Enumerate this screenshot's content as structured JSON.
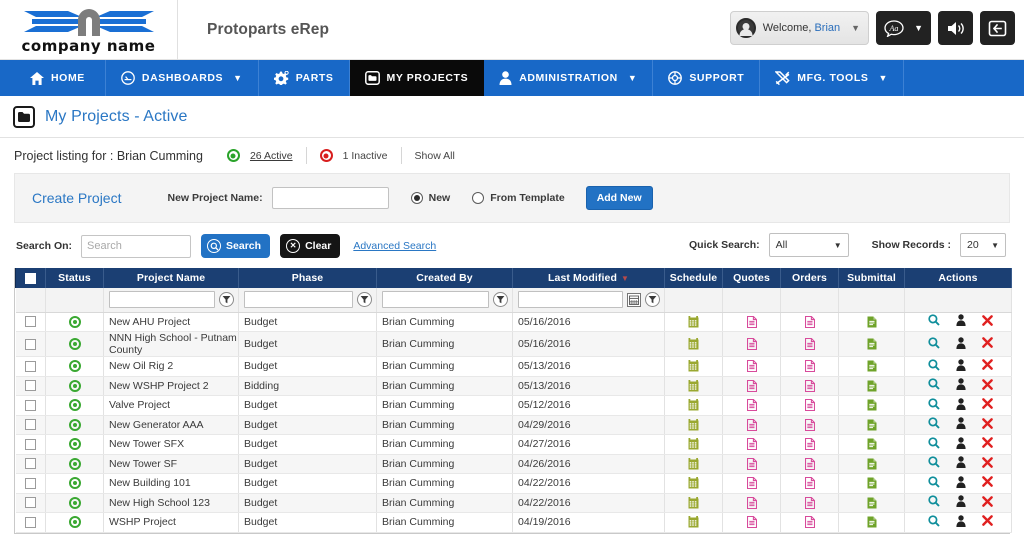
{
  "header": {
    "logo_text": "company name",
    "app_title": "Protoparts eRep",
    "welcome_prefix": "Welcome, ",
    "welcome_user": "Brian",
    "icons": {
      "user_avatar": "avatar-icon",
      "chevron": "chevron-down-icon",
      "translate": "translate-speech-icon",
      "sound": "speaker-icon",
      "logout": "logout-icon"
    },
    "accent_blue": "#1868c7",
    "link_blue": "#2a77c4"
  },
  "nav": {
    "items": [
      {
        "label": "HOME",
        "icon": "home-icon",
        "caret": false,
        "active": false
      },
      {
        "label": "DASHBOARDS",
        "icon": "dashboard-gauge-icon",
        "caret": true,
        "active": false
      },
      {
        "label": "PARTS",
        "icon": "gear-icon",
        "caret": false,
        "active": false
      },
      {
        "label": "MY PROJECTS",
        "icon": "folder-icon",
        "caret": false,
        "active": true
      },
      {
        "label": "ADMINISTRATION",
        "icon": "person-icon",
        "caret": true,
        "active": false
      },
      {
        "label": "SUPPORT",
        "icon": "lifering-icon",
        "caret": false,
        "active": false
      },
      {
        "label": "MFG. TOOLS",
        "icon": "tools-icon",
        "caret": true,
        "active": false
      }
    ]
  },
  "page": {
    "title": "My Projects - Active",
    "title_icon": "folder-outline-icon"
  },
  "listing": {
    "label": "Project listing for : Brian Cumming",
    "active_count": "26 Active",
    "inactive_count": "1 Inactive",
    "show_all": "Show All",
    "active_dot_color": "#2aa32a",
    "inactive_dot_color": "#d81e1e"
  },
  "create_project": {
    "title": "Create Project",
    "name_label": "New Project Name:",
    "name_value": "",
    "name_placeholder": "",
    "radio_new": "New",
    "radio_template": "From Template",
    "radio_selected": "New",
    "add_button": "Add New"
  },
  "search": {
    "search_on_label": "Search On:",
    "input_value": "",
    "input_placeholder": "Search",
    "search_button": "Search",
    "clear_button": "Clear",
    "advanced_link": "Advanced Search",
    "quick_search_label": "Quick Search:",
    "quick_search_value": "All",
    "show_records_label": "Show Records :",
    "show_records_value": "20"
  },
  "table": {
    "columns": [
      "Status",
      "Project Name",
      "Phase",
      "Created By",
      "Last Modified",
      "Schedule",
      "Quotes",
      "Orders",
      "Submittal",
      "Actions"
    ],
    "sorted_column": "Last Modified",
    "filter_values": {
      "project_name": "",
      "phase": "",
      "created_by": "",
      "last_modified": ""
    },
    "icon_colors": {
      "schedule": "#9aa830",
      "quotes": "#d84a9b",
      "orders": "#d84a9b",
      "submittal": "#6fa32a",
      "view": "#0f8e9b",
      "user": "#222222",
      "delete": "#e02020"
    },
    "rows": [
      {
        "checked": false,
        "status": "active",
        "project_name": "New AHU Project",
        "phase": "Budget",
        "created_by": "Brian Cumming",
        "last_modified": "05/16/2016"
      },
      {
        "checked": false,
        "status": "active",
        "project_name": "NNN High School - Putnam County",
        "phase": "Budget",
        "created_by": "Brian Cumming",
        "last_modified": "05/16/2016"
      },
      {
        "checked": false,
        "status": "active",
        "project_name": "New Oil Rig 2",
        "phase": "Budget",
        "created_by": "Brian Cumming",
        "last_modified": "05/13/2016"
      },
      {
        "checked": false,
        "status": "active",
        "project_name": "New WSHP Project 2",
        "phase": "Bidding",
        "created_by": "Brian Cumming",
        "last_modified": "05/13/2016"
      },
      {
        "checked": false,
        "status": "active",
        "project_name": "Valve Project",
        "phase": "Budget",
        "created_by": "Brian Cumming",
        "last_modified": "05/12/2016"
      },
      {
        "checked": false,
        "status": "active",
        "project_name": "New Generator AAA",
        "phase": "Budget",
        "created_by": "Brian Cumming",
        "last_modified": "04/29/2016"
      },
      {
        "checked": false,
        "status": "active",
        "project_name": "New Tower SFX",
        "phase": "Budget",
        "created_by": "Brian Cumming",
        "last_modified": "04/27/2016"
      },
      {
        "checked": false,
        "status": "active",
        "project_name": "New Tower SF",
        "phase": "Budget",
        "created_by": "Brian Cumming",
        "last_modified": "04/26/2016"
      },
      {
        "checked": false,
        "status": "active",
        "project_name": "New Building 101",
        "phase": "Budget",
        "created_by": "Brian Cumming",
        "last_modified": "04/22/2016"
      },
      {
        "checked": false,
        "status": "active",
        "project_name": "New High School 123",
        "phase": "Budget",
        "created_by": "Brian Cumming",
        "last_modified": "04/22/2016"
      },
      {
        "checked": false,
        "status": "active",
        "project_name": "WSHP Project",
        "phase": "Budget",
        "created_by": "Brian Cumming",
        "last_modified": "04/19/2016"
      }
    ]
  }
}
